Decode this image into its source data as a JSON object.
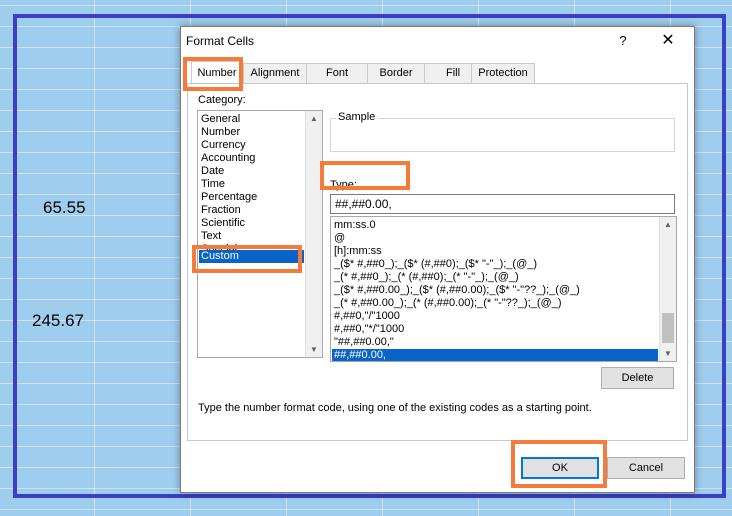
{
  "sheet": {
    "cells": [
      "65.55",
      "245.67"
    ]
  },
  "dialog": {
    "title": "Format Cells",
    "help": "?",
    "close": "✕",
    "tabs": [
      "Number",
      "Alignment",
      "Font",
      "Border",
      "Fill",
      "Protection"
    ],
    "active_tab": "Number",
    "category_label": "Category:",
    "categories": [
      "General",
      "Number",
      "Currency",
      "Accounting",
      "Date",
      "Time",
      "Percentage",
      "Fraction",
      "Scientific",
      "Text",
      "Special",
      "Custom"
    ],
    "selected_category": "Custom",
    "sample_label": "Sample",
    "type_label": "Type:",
    "type_value": "##,##0.00,",
    "format_codes": [
      "mm:ss.0",
      "@",
      "[h]:mm:ss",
      "_($* #,##0_);_($* (#,##0);_($* \"-\"_);_(@_)",
      "_(* #,##0_);_(* (#,##0);_(* \"-\"_);_(@_)",
      "_($* #,##0.00_);_($* (#,##0.00);_($* \"-\"??_);_(@_)",
      "_(* #,##0.00_);_(* (#,##0.00);_(* \"-\"??_);_(@_)",
      "#,##0,\"/\"1000",
      "#,##0,\"*/\"1000",
      " \"##,##0.00,\"",
      "##,##0.00,"
    ],
    "selected_code": "##,##0.00,",
    "delete_label": "Delete",
    "description": "Type the number format code, using one of the existing codes as a starting point.",
    "ok_label": "OK",
    "cancel_label": "Cancel"
  }
}
